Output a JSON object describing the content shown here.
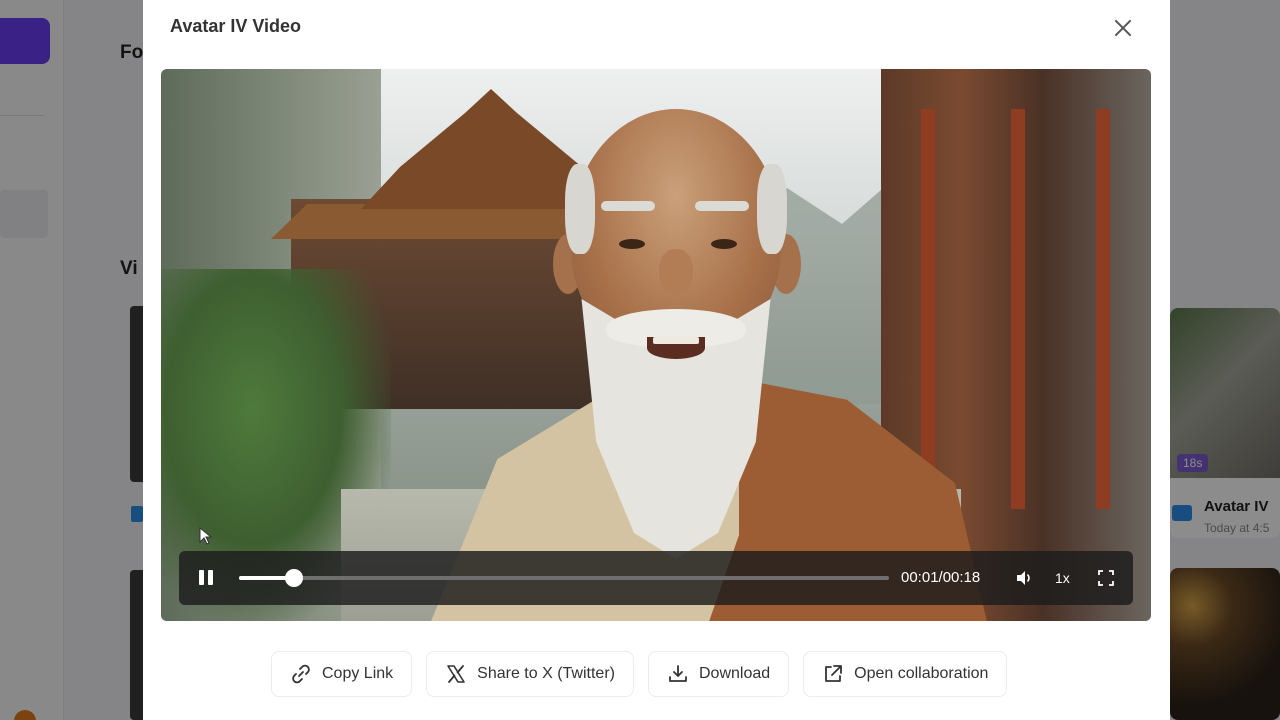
{
  "background": {
    "section_heading_1": "Fo",
    "section_heading_2": "Vi",
    "card_duration_badge": "18s",
    "card_title": "Avatar IV",
    "card_time": "Today at 4:5"
  },
  "modal": {
    "title": "Avatar IV Video",
    "close_icon": "close-icon"
  },
  "player": {
    "current_time": "00:01",
    "duration": "00:18",
    "time_display": "00:01/00:18",
    "progress": 0.085,
    "speed": "1x",
    "state": "playing",
    "icons": {
      "pause": "pause-icon",
      "volume": "volume-icon",
      "fullscreen": "fullscreen-icon"
    }
  },
  "actions": [
    {
      "label": "Copy Link",
      "icon": "link-icon"
    },
    {
      "label": "Share to X (Twitter)",
      "icon": "x-logo-icon"
    },
    {
      "label": "Download",
      "icon": "download-icon"
    },
    {
      "label": "Open collaboration",
      "icon": "external-link-icon"
    }
  ],
  "colors": {
    "accent": "#6a3cf5",
    "overlay": "rgba(0,0,0,0.45)",
    "control_bar": "#1c1c1c"
  }
}
